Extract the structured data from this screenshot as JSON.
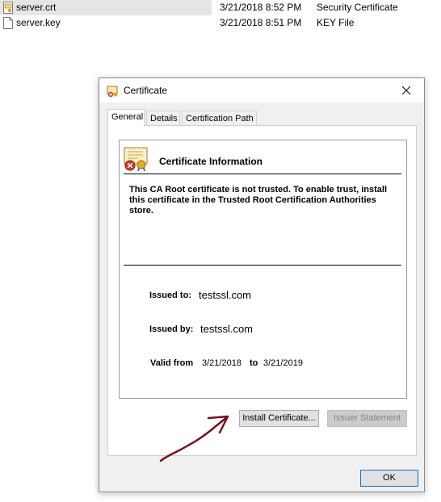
{
  "files": [
    {
      "name": "server.crt",
      "date": "3/21/2018 8:52 PM",
      "type": "Security Certificate",
      "selected": true
    },
    {
      "name": "server.key",
      "date": "3/21/2018 8:51 PM",
      "type": "KEY File",
      "selected": false
    }
  ],
  "dialog": {
    "title": "Certificate",
    "tabs": [
      "General",
      "Details",
      "Certification Path"
    ],
    "active_tab": "General",
    "info_heading": "Certificate Information",
    "warning": "This CA Root certificate is not trusted. To enable trust, install this certificate in the Trusted Root Certification Authorities store.",
    "issued_to_label": "Issued to:",
    "issued_to_value": "testssl.com",
    "issued_by_label": "Issued by:",
    "issued_by_value": "testssl.com",
    "valid_from_label": "Valid from",
    "valid_from_value": "3/21/2018",
    "valid_to_label": "to",
    "valid_to_value": "3/21/2019",
    "install_button": "Install Certificate...",
    "issuer_statement_button": "Issuer Statement",
    "ok_button": "OK"
  },
  "colors": {
    "dialog_bg": "#f0f0f0",
    "selection": "#e5e5e5",
    "annotation_arrow": "#7a0f18",
    "ok_border": "#0078d7"
  }
}
